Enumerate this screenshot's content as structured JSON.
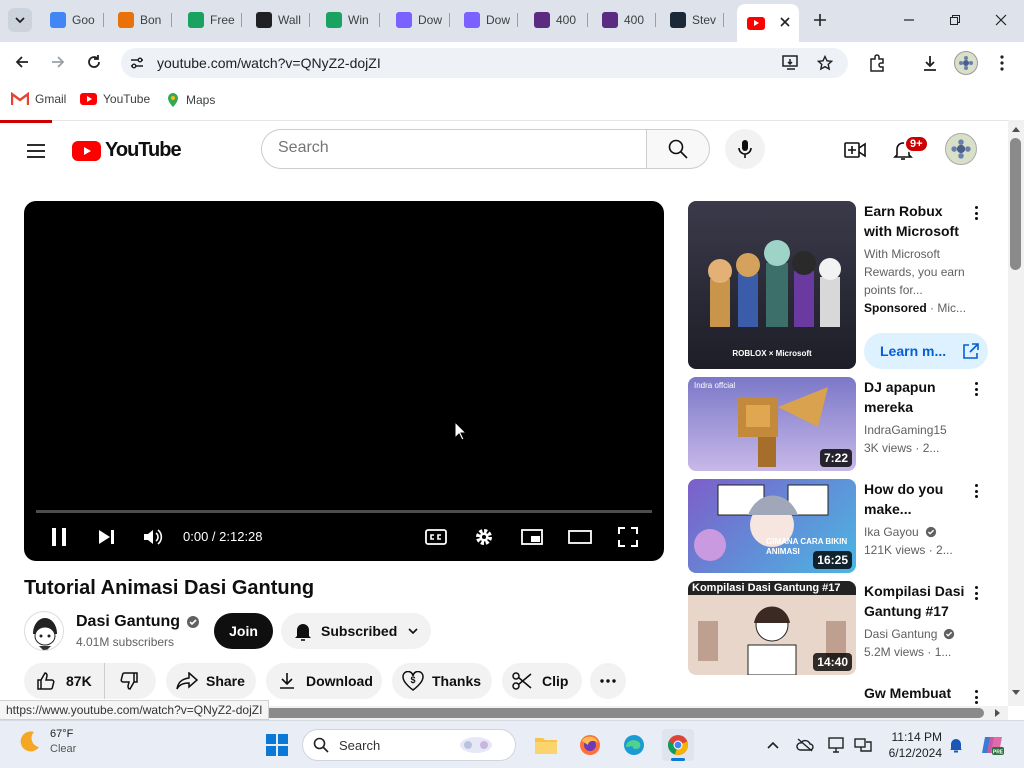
{
  "browser": {
    "tabs": [
      {
        "label": "Goo",
        "icon": "google-icon",
        "color": "#4285f4"
      },
      {
        "label": "Bon",
        "icon": "rainbow-icon",
        "color": "#e8710a"
      },
      {
        "label": "Free",
        "icon": "doc-icon",
        "color": "#1aa260"
      },
      {
        "label": "Wall",
        "icon": "star-icon",
        "color": "#202124"
      },
      {
        "label": "Win",
        "icon": "doc-icon",
        "color": "#1aa260"
      },
      {
        "label": "Dow",
        "icon": "ring-icon",
        "color": "#7b61ff"
      },
      {
        "label": "Dow",
        "icon": "ring-icon",
        "color": "#7b61ff"
      },
      {
        "label": "400",
        "icon": "image-icon",
        "color": "#5b2b82"
      },
      {
        "label": "400",
        "icon": "image-icon",
        "color": "#5b2b82"
      },
      {
        "label": "Stev",
        "icon": "steam-icon",
        "color": "#1b2838"
      }
    ],
    "url": "youtube.com/watch?v=QNyZ2-dojZI",
    "bookmarks": [
      "Gmail",
      "YouTube",
      "Maps"
    ],
    "status_url": "https://www.youtube.com/watch?v=QNyZ2-dojZI"
  },
  "youtube": {
    "logo_text": "YouTube",
    "search_placeholder": "Search",
    "notif_badge": "9+",
    "player": {
      "time": "0:00 / 2:12:28",
      "progress": 0
    },
    "video_title": "Tutorial Animasi Dasi Gantung",
    "channel": {
      "name": "Dasi Gantung",
      "subscribers": "4.01M subscribers"
    },
    "join_label": "Join",
    "subscribed_label": "Subscribed",
    "actions": {
      "likes": "87K",
      "share": "Share",
      "download": "Download",
      "thanks": "Thanks",
      "clip": "Clip"
    },
    "sidebar": [
      {
        "title": "Earn Robux with Microsoft",
        "desc": "With Microsoft Rewards, you earn points for...",
        "sponsored": "Sponsored",
        "advertiser": "Mic...",
        "cta": "Learn m...",
        "thumb_text": "ROBLOX × Microsoft"
      },
      {
        "title": "DJ apapun mereka bilang...",
        "channel": "IndraGaming15",
        "views": "3K views",
        "age": "2...",
        "duration": "7:22",
        "thumb_text": "Indra offcial"
      },
      {
        "title": "How do you make...",
        "channel": "Ika Gayou",
        "views": "121K views",
        "age": "2...",
        "duration": "16:25",
        "thumb_text": "GIMANA CARA BIKIN ANIMASI"
      },
      {
        "title": "Kompilasi Dasi Gantung #17",
        "channel": "Dasi Gantung",
        "views": "5.2M views",
        "age": "1...",
        "duration": "14:40",
        "thumb_text": "Kompilasi Dasi Gantung #17"
      },
      {
        "title": "Gw Membuat"
      }
    ]
  },
  "taskbar": {
    "weather_temp": "67°F",
    "weather_desc": "Clear",
    "search_label": "Search",
    "time": "11:14 PM",
    "date": "6/12/2024"
  },
  "colors": {
    "youtube_red": "#ff0000",
    "accent_blue": "#065fd4"
  }
}
